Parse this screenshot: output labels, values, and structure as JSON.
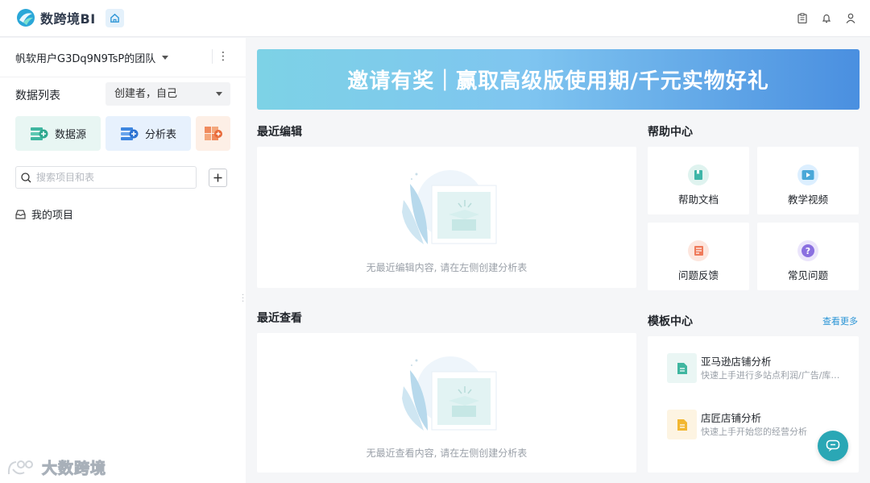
{
  "app": {
    "name": "数跨境BI"
  },
  "sidebar": {
    "team_name": "帆软用户G3Dq9N9TsP的团队",
    "list_title": "数据列表",
    "creator_filter": "创建者，自己",
    "tiles": {
      "datasource": "数据源",
      "analysis": "分析表"
    },
    "search_placeholder": "搜索项目和表",
    "my_projects": "我的项目"
  },
  "banner": {
    "text": "邀请有奖｜赢取高级版使用期/千元实物好礼"
  },
  "recent_edit": {
    "title": "最近编辑",
    "empty_text": "无最近编辑内容, 请在左侧创建分析表"
  },
  "recent_view": {
    "title": "最近查看",
    "empty_text": "无最近查看内容, 请在左侧创建分析表"
  },
  "help_center": {
    "title": "帮助中心",
    "items": [
      {
        "label": "帮助文档",
        "color": "#3fb6a8"
      },
      {
        "label": "教学视频",
        "color": "#4aa8d8"
      },
      {
        "label": "问题反馈",
        "color": "#ef7a5a"
      },
      {
        "label": "常见问题",
        "color": "#8a6fe0"
      }
    ]
  },
  "template_center": {
    "title": "模板中心",
    "more": "查看更多",
    "items": [
      {
        "title": "亚马逊店铺分析",
        "desc": "快速上手进行多站点利润/广告/库存分析"
      },
      {
        "title": "店匠店铺分析",
        "desc": "快速上手开始您的经营分析"
      }
    ]
  },
  "watermark": {
    "text": "大数跨境"
  },
  "colors": {
    "accent": "#2aa7b5",
    "link": "#2b95d6"
  }
}
